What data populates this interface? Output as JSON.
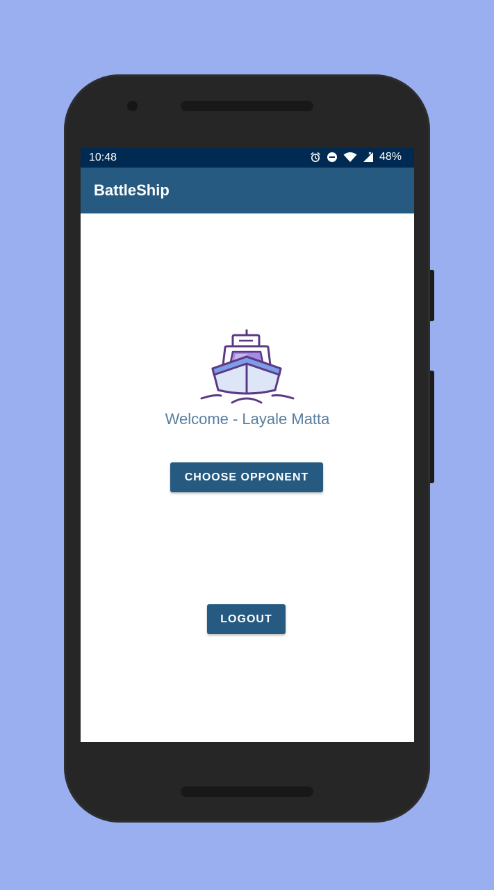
{
  "status_bar": {
    "time": "10:48",
    "battery": "48%",
    "icons": [
      "alarm-icon",
      "do-not-disturb-icon",
      "wifi-icon",
      "cell-signal-icon"
    ]
  },
  "app_bar": {
    "title": "BattleShip"
  },
  "main": {
    "logo_icon": "ship-icon",
    "welcome_text": "Welcome - Layale Matta",
    "choose_opponent_label": "CHOOSE OPPONENT",
    "logout_label": "LOGOUT"
  },
  "colors": {
    "background": "#99aff0",
    "status_bar": "#012a52",
    "app_bar": "#265a80",
    "button": "#265a80",
    "welcome_text": "#587ea0"
  }
}
